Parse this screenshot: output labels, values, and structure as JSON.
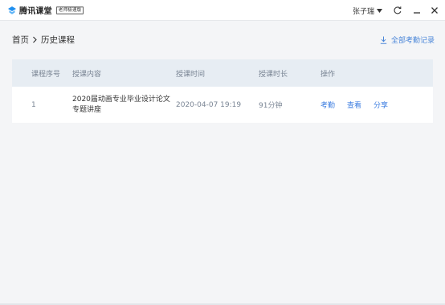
{
  "app": {
    "name": "腾讯课堂",
    "badge": "老师极速版",
    "brand_color": "#1e8ff0"
  },
  "titlebar": {
    "user_name": "张子瑞"
  },
  "breadcrumb": {
    "home": "首页",
    "current": "历史课程"
  },
  "actions": {
    "export_label": "全部考勤记录",
    "link_color": "#3d7ee0"
  },
  "table": {
    "headers": {
      "index": "课程序号",
      "content": "授课内容",
      "time": "授课时间",
      "duration": "授课时长",
      "ops": "操作"
    },
    "rows": [
      {
        "index": "1",
        "content": "2020届动画专业毕业设计论文专题讲座",
        "time": "2020-04-07 19:19",
        "duration": "91分钟",
        "ops": [
          "考勤",
          "查看",
          "分享"
        ]
      }
    ]
  }
}
